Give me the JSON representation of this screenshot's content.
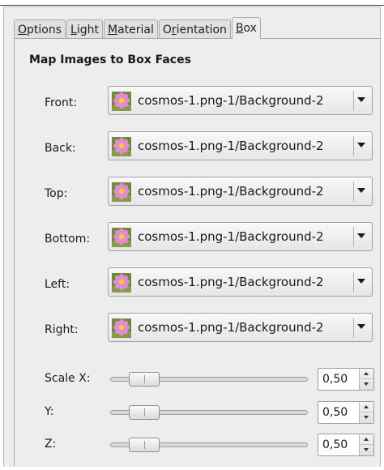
{
  "tabs": [
    {
      "label_pre": "",
      "label_ul": "O",
      "label_post": "ptions"
    },
    {
      "label_pre": "",
      "label_ul": "L",
      "label_post": "ight"
    },
    {
      "label_pre": "",
      "label_ul": "M",
      "label_post": "aterial"
    },
    {
      "label_pre": "O",
      "label_ul": "r",
      "label_post": "ientation"
    },
    {
      "label_pre": "",
      "label_ul": "B",
      "label_post": "ox"
    }
  ],
  "active_tab": "Box",
  "section": {
    "title": "Map Images to Box Faces"
  },
  "faces": [
    {
      "label": "Front:",
      "value": "cosmos-1.png-1/Background-2",
      "icon": "flower-thumbnail-icon"
    },
    {
      "label": "Back:",
      "value": "cosmos-1.png-1/Background-2",
      "icon": "flower-thumbnail-icon"
    },
    {
      "label": "Top:",
      "value": "cosmos-1.png-1/Background-2",
      "icon": "flower-thumbnail-icon"
    },
    {
      "label": "Bottom:",
      "value": "cosmos-1.png-1/Background-2",
      "icon": "flower-thumbnail-icon"
    },
    {
      "label": "Left:",
      "value": "cosmos-1.png-1/Background-2",
      "icon": "flower-thumbnail-icon"
    },
    {
      "label": "Right:",
      "value": "cosmos-1.png-1/Background-2",
      "icon": "flower-thumbnail-icon"
    }
  ],
  "scales": [
    {
      "label": "Scale X:",
      "value": "0,50",
      "fraction": 0.1
    },
    {
      "label": "Y:",
      "value": "0,50",
      "fraction": 0.1
    },
    {
      "label": "Z:",
      "value": "0,50",
      "fraction": 0.1
    }
  ],
  "colors": {
    "background": "#ededed",
    "flower_petal": "#e58ad0",
    "flower_center": "#e6d23c",
    "foliage": "#6e8a3a"
  }
}
